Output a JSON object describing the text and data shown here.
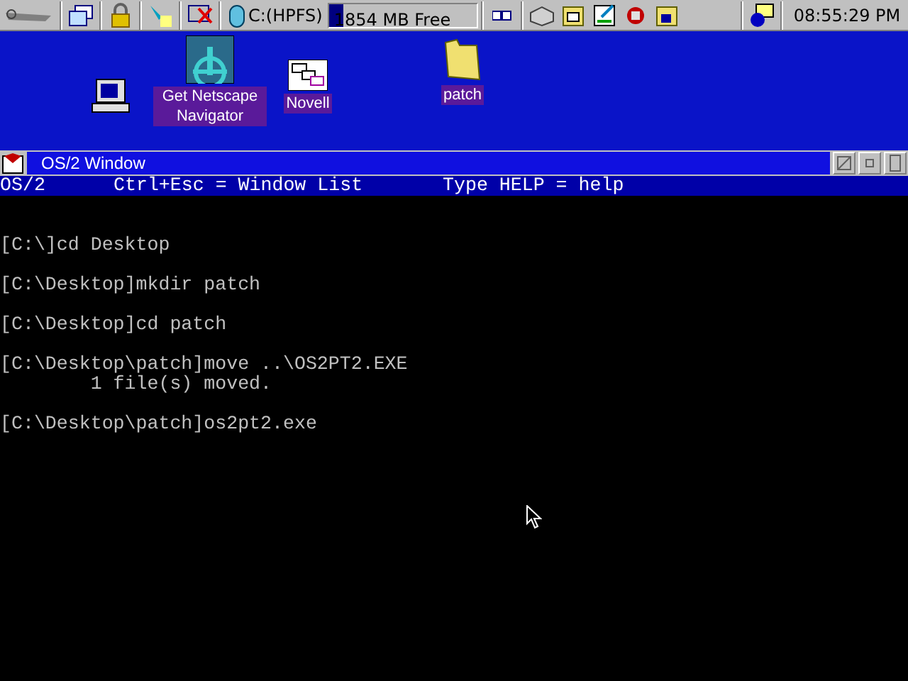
{
  "toolbar": {
    "drive": {
      "label": "C:(HPFS)",
      "free": "1854 MB Free",
      "level": 0.09
    },
    "clock": "08:55:29 PM"
  },
  "desktop": {
    "icons": [
      {
        "kind": "computer"
      },
      {
        "kind": "wheel",
        "label": "Get Netscape Navigator"
      },
      {
        "kind": "windows",
        "label": "Novell"
      },
      {
        "kind": "folder",
        "label": "patch"
      }
    ]
  },
  "window": {
    "title": "OS/2 Window",
    "status": [
      {
        "text": "OS/2"
      },
      {
        "text": "Ctrl+Esc = Window List"
      },
      {
        "text": "Type HELP = help"
      }
    ],
    "blocks": [
      {
        "lines": [
          "[C:\\]cd Desktop"
        ]
      },
      {
        "lines": [
          "[C:\\Desktop]mkdir patch"
        ]
      },
      {
        "lines": [
          "[C:\\Desktop]cd patch"
        ]
      },
      {
        "lines": [
          "[C:\\Desktop\\patch]move ..\\OS2PT2.EXE",
          "        1 file(s) moved."
        ]
      },
      {
        "lines": [
          "[C:\\Desktop\\patch]os2pt2.exe"
        ]
      }
    ]
  }
}
